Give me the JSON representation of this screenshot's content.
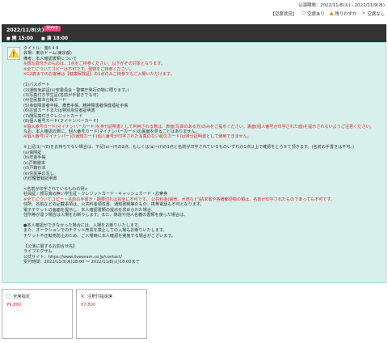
{
  "top": {
    "period": "公演期間：2022/11/8(火) - 2022/11/9(水)",
    "legend_title": "【空席状況】",
    "legend": [
      {
        "symbol": "○",
        "label": "空席あり",
        "icon": "circle-icon",
        "color": "#1a6ec7"
      },
      {
        "symbol": "▲",
        "label": "残りわずか",
        "icon": "triangle-icon",
        "color": "#e07b00"
      },
      {
        "symbol": "×",
        "label": "空席なし",
        "icon": "cross-icon",
        "color": "#666666"
      }
    ]
  },
  "event": {
    "date": "2022/11/8(火)",
    "badge": "発売中",
    "open_label": "開",
    "open_time": "15:00",
    "start_label": "演",
    "start_time": "18:00"
  },
  "notice": {
    "icon": "warning-icon",
    "lines": [
      {
        "text": "タイトル：嵐6 4 6",
        "red": false
      },
      {
        "text": "会場：東京ドーム(東京都)",
        "red": false
      },
      {
        "text": "備考：本人確認書類について",
        "red": false
      },
      {
        "text": "※顔写真付きのものは、1点をご持参ください。以下がその対象となります。",
        "red": true
      },
      {
        "text": "※全てについてコピーは不可です。現物をご持参ください。",
        "red": true
      },
      {
        "text": "※12歳までのお客様は【健康保険証】の1点のみご持参でもご入場いただけます。",
        "red": true
      },
      {
        "text": "",
        "red": false
      },
      {
        "text": "(1)パスポート",
        "red": false
      },
      {
        "text": "(2)運転免許証(公安委員会・警察庁発行の物に限ります。)",
        "red": false
      },
      {
        "text": "(3)写真付き学生証(名前が手書きでも可)",
        "red": false
      },
      {
        "text": "(4)住民基本台帳カード",
        "red": false
      },
      {
        "text": "(5)身体障害者手帳、療育手帳、精神障害者保健福祉手帳",
        "red": false
      },
      {
        "text": "(6)在留カードまたは特別永住者証明書",
        "red": false
      },
      {
        "text": "(7)顔写真付きクレジットカード",
        "red": false
      },
      {
        "text": "(8)個人番号カード(マイナンバーカード)",
        "red": false
      },
      {
        "text": "※個人番号カード(マイナンバーカード)を身分証明書として利用される際は、表面(写真のある方)のみをご提示ください。裏面(個人番号が印字された面)を提示されないようご注意ください。",
        "red": true,
        "wrap": true
      },
      {
        "text": "なお、本人確認の際に、個人番号カード(マイナンバーカード)の裏面を見ることはありません。",
        "red": false
      },
      {
        "text": "※個人番号(マイナンバー)の通知カード(個人番号が印字された写真のない紙のカード)は身分証明書として使用できません。",
        "red": true
      },
      {
        "text": "",
        "red": false
      },
      {
        "text": "※上記(1)~(8)をお持ちでない場合は、下記(a)~(f)の2点、もしくは(a)~(f)の1点と名前が印字されているものいずれか1点以上で確認をとらせて頂きます。(名前の手書きは不可。)",
        "red": false,
        "wrap": true
      },
      {
        "text": "(a)保険証",
        "red": false
      },
      {
        "text": "(b)年金手帳",
        "red": false
      },
      {
        "text": "(c)戸籍謄本",
        "red": false
      },
      {
        "text": "(d)戸籍抄本",
        "red": false
      },
      {
        "text": "(e)住民票の写し",
        "red": false
      },
      {
        "text": "(f)印鑑登録証明書",
        "red": false
      },
      {
        "text": "",
        "red": false
      },
      {
        "text": "<名前が印字されているものの例>",
        "red": false
      },
      {
        "text": "社員証・顔写真の無い学生証・クレジットカード・キャッシュカード・診察券",
        "red": false
      },
      {
        "text": "※全てについてコピー・名前の手書き・期限切れは完全に不可です。 公共料金(電気、水道など)請求書や各種郵便物の類は、名前が印字されたものであっても不可です。",
        "red": true
      },
      {
        "text": "住所、名前などの記載事項は、公共料金領収書、通知書類等のもの、携帯電話も不可となります。",
        "red": false
      },
      {
        "text": "電子チケットの画面を提示し、本人確認書類の提示を求められた場合、",
        "red": false
      },
      {
        "text": "住所等が違う場合は入場をお断りします。また、偽造や他人名義の書類を使った場合は、",
        "red": false
      },
      {
        "text": "",
        "red": false
      },
      {
        "text": "●本人確認ができなかった場合には、入場をお断りいたします。",
        "red": false
      },
      {
        "text": "また、オークションでのチケット売買を禁止しての入場もお断りいたします。",
        "red": false
      },
      {
        "text": "チケット不正転売防止のため、ご入場時に本人確認を実施する場合がございます。",
        "red": false
      },
      {
        "text": "",
        "red": false
      },
      {
        "text": "【公演に関するお問合せ先】",
        "red": false
      },
      {
        "text": "ライブエグザム",
        "red": false
      },
      {
        "text": "公式サイト：https://www.liveexam.co.jp/contact/",
        "red": false
      },
      {
        "text": "受付時間：2022/11/3(木)18:00 〜 2022/11/8(火)18:00まで",
        "red": false
      }
    ]
  },
  "seats": [
    {
      "symbol": "○",
      "icon": "circle-icon",
      "name": "全席指定",
      "price": "¥9,800"
    },
    {
      "symbol": "×",
      "icon": "cross-icon",
      "name": "注釈付指定席",
      "price": "¥7,800"
    }
  ]
}
